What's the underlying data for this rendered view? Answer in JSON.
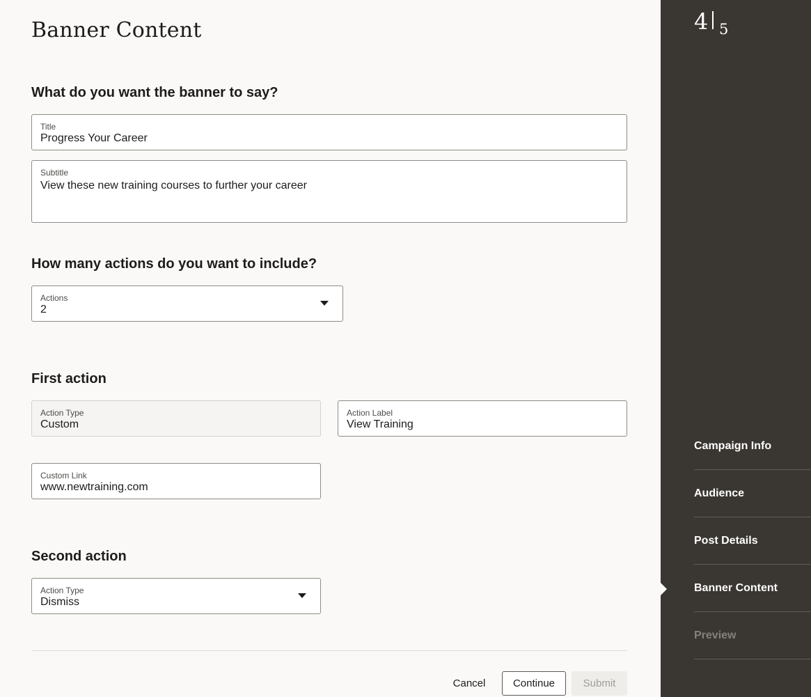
{
  "page": {
    "title": "Banner Content"
  },
  "banner_text": {
    "heading": "What do you want the banner to say?",
    "title_label": "Title",
    "title_value": "Progress Your Career",
    "subtitle_label": "Subtitle",
    "subtitle_value": "View these new training courses to further your career"
  },
  "actions_count": {
    "heading": "How many actions do you want to include?",
    "label": "Actions",
    "value": "2"
  },
  "first_action": {
    "heading": "First action",
    "type_label": "Action Type",
    "type_value": "Custom",
    "action_label_label": "Action Label",
    "action_label_value": "View Training",
    "link_label": "Custom Link",
    "link_value": "www.newtraining.com"
  },
  "second_action": {
    "heading": "Second action",
    "type_label": "Action Type",
    "type_value": "Dismiss"
  },
  "footer": {
    "cancel_label": "Cancel",
    "continue_label": "Continue",
    "submit_label": "Submit"
  },
  "sidebar": {
    "current_step": "4",
    "total_steps": "5",
    "steps": [
      {
        "label": "Campaign Info",
        "state": "completed"
      },
      {
        "label": "Audience",
        "state": "completed"
      },
      {
        "label": "Post Details",
        "state": "completed"
      },
      {
        "label": "Banner Content",
        "state": "current"
      },
      {
        "label": "Preview",
        "state": "disabled"
      }
    ]
  }
}
